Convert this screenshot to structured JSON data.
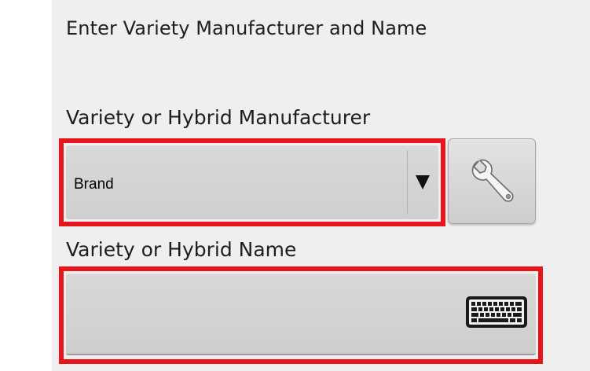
{
  "title": "Enter Variety Manufacturer and Name",
  "manufacturer": {
    "label": "Variety or Hybrid Manufacturer",
    "selected_value": "Brand",
    "arrow_icon": "dropdown-arrow",
    "settings_icon": "wrench-icon"
  },
  "name": {
    "label": "Variety or Hybrid Name",
    "value": "",
    "keyboard_icon": "keyboard-icon"
  },
  "colors": {
    "highlight": "#e8141b",
    "panel_background": "#efefef",
    "control_background": "#d3d3d3"
  }
}
